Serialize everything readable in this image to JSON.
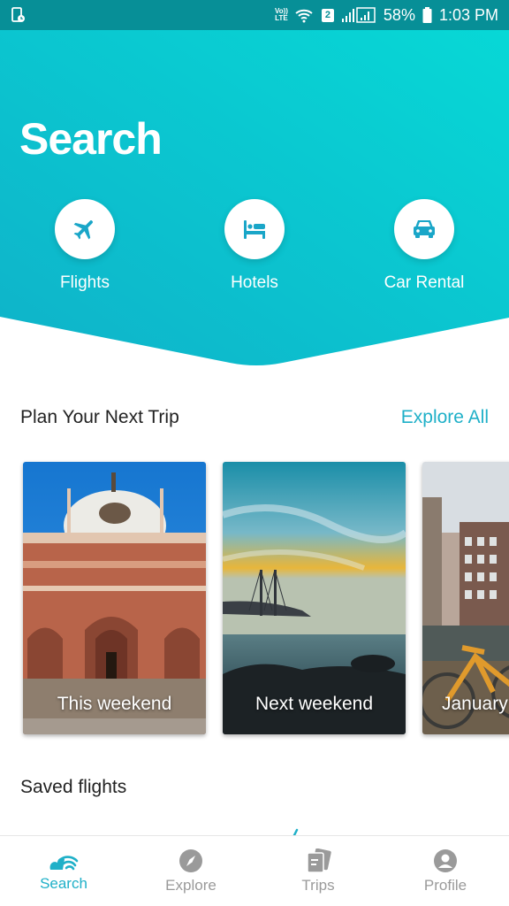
{
  "status_bar": {
    "volte": "Vo)) LTE",
    "sim": "2",
    "battery": "58%",
    "time": "1:03 PM"
  },
  "header": {
    "title": "Search",
    "gradient_from": "#0fb6c9",
    "gradient_to": "#08d6d6",
    "categories": [
      {
        "label": "Flights",
        "icon": "airplane-icon"
      },
      {
        "label": "Hotels",
        "icon": "bed-icon"
      },
      {
        "label": "Car Rental",
        "icon": "car-icon"
      }
    ]
  },
  "plan": {
    "title": "Plan Your Next Trip",
    "explore_all": "Explore All",
    "cards": [
      {
        "label": "This weekend"
      },
      {
        "label": "Next weekend"
      },
      {
        "label": "January"
      }
    ]
  },
  "saved": {
    "title": "Saved flights"
  },
  "bottom_nav": {
    "accent": "#1fb0c8",
    "items": [
      {
        "label": "Search",
        "active": true
      },
      {
        "label": "Explore",
        "active": false
      },
      {
        "label": "Trips",
        "active": false
      },
      {
        "label": "Profile",
        "active": false
      }
    ]
  }
}
